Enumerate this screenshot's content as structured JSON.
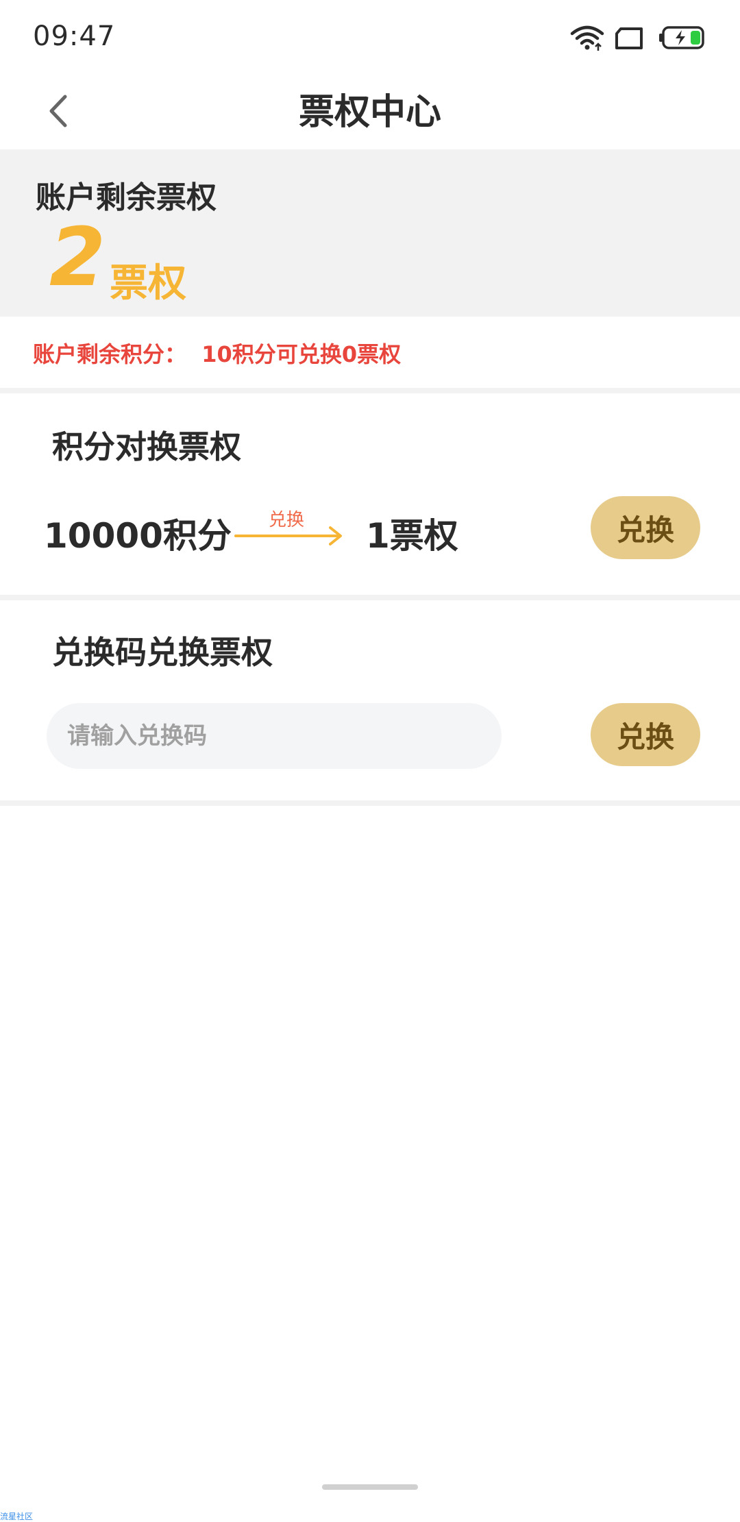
{
  "status_bar": {
    "time": "09:47",
    "icons": [
      "wifi-icon",
      "sim-card-icon",
      "battery-charging-icon"
    ],
    "battery_color": "#2ecc40"
  },
  "header": {
    "title": "票权中心",
    "back_icon": "chevron-left-icon"
  },
  "balance": {
    "label": "账户剩余票权",
    "value": "2",
    "unit": "票权"
  },
  "points": {
    "text": "账户剩余积分：  10积分可兑换0票权"
  },
  "points_exchange": {
    "title": "积分对换票权",
    "from": "10000积分",
    "arrow_label": "兑换",
    "to": "1票权",
    "button_label": "兑换"
  },
  "code_exchange": {
    "title": "兑换码兑换票权",
    "input_placeholder": "请输入兑换码",
    "input_value": "",
    "button_label": "兑换"
  },
  "colors": {
    "accent": "#f6b535",
    "button_bg": "#e6cb8a",
    "button_text": "#6b4e14",
    "warning_text": "#e8463c"
  },
  "watermark": "流星社区"
}
